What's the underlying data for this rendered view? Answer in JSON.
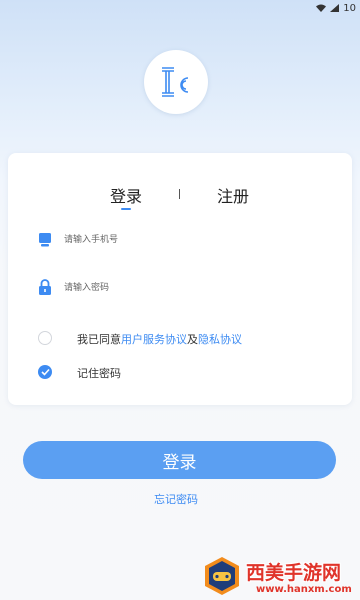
{
  "status_bar": {
    "wifi_icon": "wifi-icon",
    "signal_icon": "signal-icon",
    "battery_text": "10"
  },
  "logo": {
    "icon": "app-logo-icon",
    "text": "Ic",
    "color": "#3d8bf2"
  },
  "tabs": [
    {
      "label": "登录",
      "active": true
    },
    {
      "label": "注册",
      "active": false
    }
  ],
  "fields": {
    "phone": {
      "icon": "phone-icon",
      "placeholder": "请输入手机号",
      "value": ""
    },
    "password": {
      "icon": "lock-icon",
      "placeholder": "请输入密码",
      "value": ""
    }
  },
  "agreement": {
    "checked": false,
    "prefix": "我已同意",
    "user_agreement": "用户服务协议",
    "connector": "及",
    "privacy_policy": "隐私协议"
  },
  "remember": {
    "checked": true,
    "label": "记住密码"
  },
  "login_button": {
    "label": "登录"
  },
  "forgot_password": {
    "label": "忘记密码"
  },
  "watermark": {
    "name": "西美手游网",
    "url": "www.hanxm.com"
  },
  "colors": {
    "accent": "#3d8bf2",
    "button": "#5b9ff2",
    "watermark": "#e0342a"
  }
}
